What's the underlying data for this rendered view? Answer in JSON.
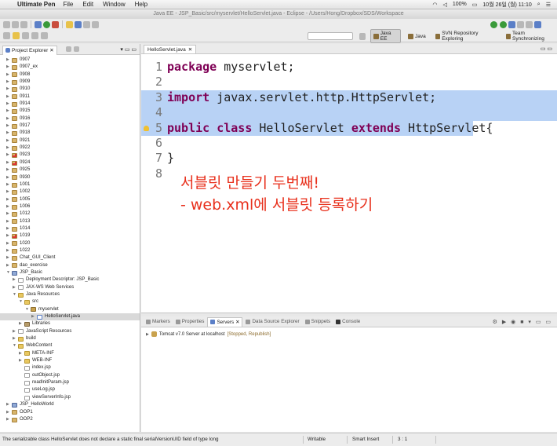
{
  "menubar": {
    "app_name": "Ultimate Pen",
    "items": [
      "File",
      "Edit",
      "Window",
      "Help"
    ],
    "battery": "100%",
    "clock": "10월 26일 (월) 11:10"
  },
  "window": {
    "title": "Java EE - JSP_Basic/src/myservlet/HelloServlet.java - Eclipse - /Users/Hong/Dropbox/SDS/Workspace"
  },
  "perspectives": [
    "Java EE",
    "Java",
    "SVN Repository Exploring",
    "Team Synchronizing"
  ],
  "explorer": {
    "title": "Project Explorer",
    "items": [
      {
        "label": "0907",
        "depth": 0,
        "icon": "proj",
        "open": false
      },
      {
        "label": "0907_ex",
        "depth": 0,
        "icon": "proj",
        "open": false
      },
      {
        "label": "0908",
        "depth": 0,
        "icon": "proj",
        "open": false
      },
      {
        "label": "0909",
        "depth": 0,
        "icon": "proj",
        "open": false
      },
      {
        "label": "0910",
        "depth": 0,
        "icon": "proj",
        "open": false
      },
      {
        "label": "0911",
        "depth": 0,
        "icon": "proj",
        "open": false
      },
      {
        "label": "0914",
        "depth": 0,
        "icon": "proj",
        "open": false
      },
      {
        "label": "0915",
        "depth": 0,
        "icon": "proj",
        "open": false
      },
      {
        "label": "0916",
        "depth": 0,
        "icon": "proj",
        "open": false
      },
      {
        "label": "0917",
        "depth": 0,
        "icon": "proj",
        "open": false
      },
      {
        "label": "0918",
        "depth": 0,
        "icon": "proj",
        "open": false
      },
      {
        "label": "0921",
        "depth": 0,
        "icon": "proj",
        "open": false
      },
      {
        "label": "0922",
        "depth": 0,
        "icon": "proj",
        "open": false
      },
      {
        "label": "0923",
        "depth": 0,
        "icon": "err",
        "open": false
      },
      {
        "label": "0924",
        "depth": 0,
        "icon": "err",
        "open": false
      },
      {
        "label": "0925",
        "depth": 0,
        "icon": "proj",
        "open": false
      },
      {
        "label": "0930",
        "depth": 0,
        "icon": "proj",
        "open": false
      },
      {
        "label": "1001",
        "depth": 0,
        "icon": "proj",
        "open": false
      },
      {
        "label": "1002",
        "depth": 0,
        "icon": "proj",
        "open": false
      },
      {
        "label": "1005",
        "depth": 0,
        "icon": "proj",
        "open": false
      },
      {
        "label": "1006",
        "depth": 0,
        "icon": "proj",
        "open": false
      },
      {
        "label": "1012",
        "depth": 0,
        "icon": "proj",
        "open": false
      },
      {
        "label": "1013",
        "depth": 0,
        "icon": "proj",
        "open": false
      },
      {
        "label": "1014",
        "depth": 0,
        "icon": "proj",
        "open": false
      },
      {
        "label": "1019",
        "depth": 0,
        "icon": "err",
        "open": false
      },
      {
        "label": "1020",
        "depth": 0,
        "icon": "proj",
        "open": false
      },
      {
        "label": "1022",
        "depth": 0,
        "icon": "proj",
        "open": false
      },
      {
        "label": "Chat_GUI_Client",
        "depth": 0,
        "icon": "proj",
        "open": false
      },
      {
        "label": "dao_exercise",
        "depth": 0,
        "icon": "proj",
        "open": false
      },
      {
        "label": "JSP_Basic",
        "depth": 0,
        "icon": "jproj",
        "open": true
      },
      {
        "label": "Deployment Descriptor: JSP_Basic",
        "depth": 1,
        "icon": "file",
        "open": false
      },
      {
        "label": "JAX-WS Web Services",
        "depth": 1,
        "icon": "file",
        "open": false
      },
      {
        "label": "Java Resources",
        "depth": 1,
        "icon": "folder",
        "open": true
      },
      {
        "label": "src",
        "depth": 2,
        "icon": "folder",
        "open": true
      },
      {
        "label": "myservlet",
        "depth": 3,
        "icon": "pkg",
        "open": true
      },
      {
        "label": "HelloServlet.java",
        "depth": 4,
        "icon": "java",
        "open": false,
        "selected": true
      },
      {
        "label": "Libraries",
        "depth": 2,
        "icon": "lib",
        "open": false
      },
      {
        "label": "JavaScript Resources",
        "depth": 1,
        "icon": "file",
        "open": false
      },
      {
        "label": "build",
        "depth": 1,
        "icon": "folder",
        "open": false
      },
      {
        "label": "WebContent",
        "depth": 1,
        "icon": "folder",
        "open": true
      },
      {
        "label": "META-INF",
        "depth": 2,
        "icon": "folder",
        "open": false
      },
      {
        "label": "WEB-INF",
        "depth": 2,
        "icon": "folder",
        "open": false
      },
      {
        "label": "index.jsp",
        "depth": 2,
        "icon": "file",
        "leaf": true
      },
      {
        "label": "outObject.jsp",
        "depth": 2,
        "icon": "file",
        "leaf": true
      },
      {
        "label": "readInitParam.jsp",
        "depth": 2,
        "icon": "file",
        "leaf": true
      },
      {
        "label": "useLog.jsp",
        "depth": 2,
        "icon": "file",
        "leaf": true
      },
      {
        "label": "viewServerInfo.jsp",
        "depth": 2,
        "icon": "file",
        "leaf": true
      },
      {
        "label": "JSP_HelloWorld",
        "depth": 0,
        "icon": "jproj",
        "open": false
      },
      {
        "label": "OOP1",
        "depth": 0,
        "icon": "proj",
        "open": false
      },
      {
        "label": "OOP2",
        "depth": 0,
        "icon": "proj",
        "open": false
      }
    ]
  },
  "editor": {
    "tab_label": "HelloServlet.java",
    "lines": [
      {
        "num": "1",
        "tokens": [
          {
            "t": "package",
            "kw": true
          },
          {
            "t": " myservlet;"
          }
        ]
      },
      {
        "num": "2",
        "tokens": []
      },
      {
        "num": "3",
        "tokens": [
          {
            "t": "import",
            "kw": true
          },
          {
            "t": " javax.servlet.http.HttpServlet;"
          }
        ],
        "highlight": "full"
      },
      {
        "num": "4",
        "tokens": [],
        "highlight": "full"
      },
      {
        "num": "5",
        "tokens": [
          {
            "t": "public",
            "kw": true
          },
          {
            "t": " "
          },
          {
            "t": "class",
            "kw": true
          },
          {
            "t": " HelloServlet "
          },
          {
            "t": "extends",
            "kw": true
          },
          {
            "t": " HttpServlet{"
          }
        ],
        "highlight": "partial",
        "warning": true
      },
      {
        "num": "6",
        "tokens": []
      },
      {
        "num": "7",
        "tokens": [
          {
            "t": "}"
          }
        ]
      },
      {
        "num": "8",
        "tokens": []
      }
    ],
    "annotation_line1": "서블릿 만들기 두번째!",
    "annotation_line2": "- web.xml에 서블릿 등록하기"
  },
  "bottom_panel": {
    "tabs": [
      "Markers",
      "Properties",
      "Servers",
      "Data Source Explorer",
      "Snippets",
      "Console"
    ],
    "active_tab": "Servers",
    "server_name": "Tomcat v7.0 Server at localhost",
    "server_status": "[Stopped, Republish]"
  },
  "statusbar": {
    "message": "The serializable class HelloServlet does not declare a static final serialVersionUID field of type long",
    "mode": "Writable",
    "insert": "Smart Insert",
    "position": "3 : 1"
  }
}
